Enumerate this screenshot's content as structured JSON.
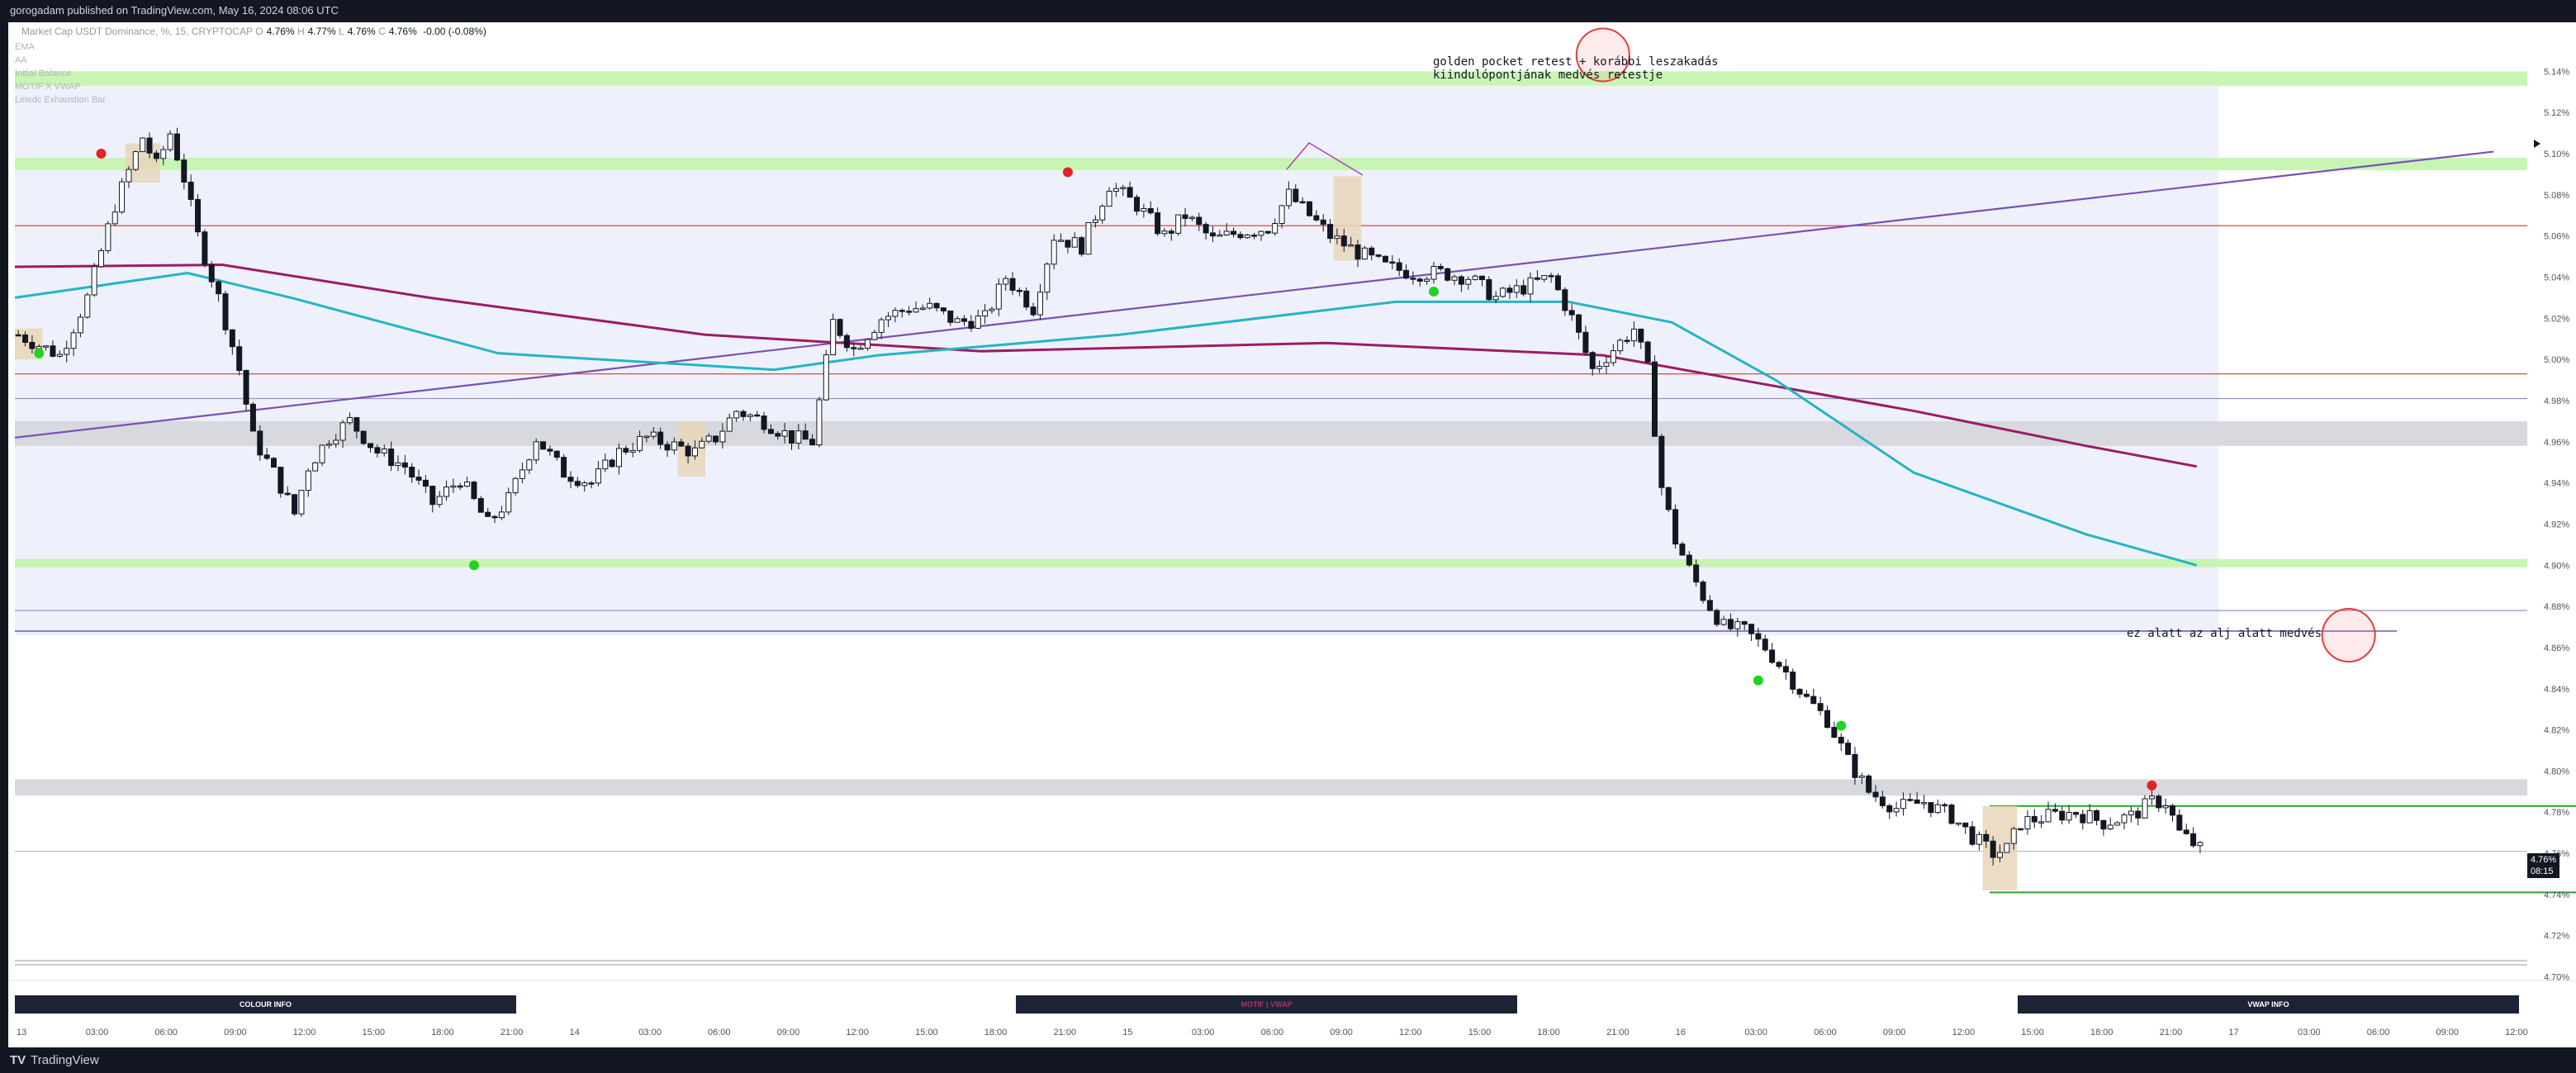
{
  "header": {
    "publish_line": "gorogadam published on TradingView.com, May 16, 2024 08:06 UTC"
  },
  "footer": {
    "brand": "TradingView"
  },
  "legend": {
    "symbol": "Market Cap USDT Dominance, %, 15, CRYPTOCAP",
    "open": "4.76%",
    "high": "4.77%",
    "low": "4.76%",
    "close": "4.76%",
    "change": "-0.00 (-0.08%)",
    "indicators": [
      "EMA",
      "AA",
      "Initial Balance",
      "MOTIF X VWAP",
      "Leledc Exhaustion Bar"
    ]
  },
  "buttons": {
    "colour_info": "COLOUR INFO",
    "motif_vwap": "MOTIF | VWAP",
    "vwap_info": "VWAP INFO"
  },
  "annotations": {
    "golden_line1": "golden pocket retest + korábbi leszakadás",
    "golden_line2": "kiindulópontjának medvés retestje",
    "below_low": "ez alatt az alj alatt medvés"
  },
  "last_price": {
    "value": "4.76%",
    "countdown": "08:15"
  },
  "colors": {
    "ema_teal": "#26b4c4",
    "ema_maroon": "#9c1c64",
    "trendline_purple": "#7b4fb5",
    "red_level": "#e0454f",
    "green_zone": "#c8f5b4",
    "grey_zone": "#d7d9de",
    "green_level": "#2aa52a",
    "info_button_bg": "#1e2235"
  },
  "chart_data": {
    "type": "candlestick",
    "title": "Market Cap USDT Dominance, %, 15, CRYPTOCAP",
    "y_unit": "%",
    "ylim": [
      4.695,
      5.155
    ],
    "y_ticks": [
      "5.14%",
      "5.12%",
      "5.10%",
      "5.08%",
      "5.06%",
      "5.04%",
      "5.02%",
      "5.00%",
      "4.98%",
      "4.96%",
      "4.94%",
      "4.92%",
      "4.90%",
      "4.88%",
      "4.86%",
      "4.84%",
      "4.82%",
      "4.80%",
      "4.78%",
      "4.76%",
      "4.74%",
      "4.72%",
      "4.70%"
    ],
    "x_ticks": [
      "13",
      "03:00",
      "06:00",
      "09:00",
      "12:00",
      "15:00",
      "18:00",
      "21:00",
      "14",
      "03:00",
      "06:00",
      "09:00",
      "12:00",
      "15:00",
      "18:00",
      "21:00",
      "15",
      "03:00",
      "06:00",
      "09:00",
      "12:00",
      "15:00",
      "18:00",
      "21:00",
      "16",
      "03:00",
      "06:00",
      "09:00",
      "12:00",
      "15:00",
      "18:00",
      "21:00",
      "17",
      "03:00",
      "06:00",
      "09:00",
      "12:00"
    ],
    "price_path": [
      [
        0,
        5.012
      ],
      [
        6,
        5.002
      ],
      [
        10,
        5.03
      ],
      [
        14,
        5.075
      ],
      [
        18,
        5.108
      ],
      [
        20,
        5.094
      ],
      [
        22,
        5.11
      ],
      [
        24,
        5.088
      ],
      [
        26,
        5.06
      ],
      [
        29,
        5.03
      ],
      [
        32,
        4.995
      ],
      [
        34,
        4.962
      ],
      [
        37,
        4.945
      ],
      [
        40,
        4.925
      ],
      [
        42,
        4.948
      ],
      [
        45,
        4.962
      ],
      [
        48,
        4.97
      ],
      [
        52,
        4.955
      ],
      [
        56,
        4.948
      ],
      [
        60,
        4.93
      ],
      [
        64,
        4.942
      ],
      [
        68,
        4.92
      ],
      [
        71,
        4.932
      ],
      [
        75,
        4.962
      ],
      [
        79,
        4.945
      ],
      [
        83,
        4.94
      ],
      [
        87,
        4.955
      ],
      [
        91,
        4.962
      ],
      [
        95,
        4.958
      ],
      [
        98,
        4.955
      ],
      [
        101,
        4.962
      ],
      [
        104,
        4.975
      ],
      [
        108,
        4.97
      ],
      [
        112,
        4.962
      ],
      [
        115,
        4.96
      ],
      [
        118,
        5.018
      ],
      [
        121,
        5.005
      ],
      [
        125,
        5.02
      ],
      [
        129,
        5.025
      ],
      [
        132,
        5.025
      ],
      [
        136,
        5.018
      ],
      [
        140,
        5.02
      ],
      [
        143,
        5.04
      ],
      [
        147,
        5.025
      ],
      [
        150,
        5.06
      ],
      [
        154,
        5.055
      ],
      [
        158,
        5.085
      ],
      [
        162,
        5.075
      ],
      [
        166,
        5.06
      ],
      [
        169,
        5.07
      ],
      [
        173,
        5.058
      ],
      [
        177,
        5.062
      ],
      [
        181,
        5.064
      ],
      [
        184,
        5.08
      ],
      [
        187,
        5.07
      ],
      [
        190,
        5.06
      ],
      [
        194,
        5.052
      ],
      [
        198,
        5.045
      ],
      [
        202,
        5.042
      ],
      [
        206,
        5.042
      ],
      [
        210,
        5.04
      ],
      [
        214,
        5.03
      ],
      [
        218,
        5.035
      ],
      [
        222,
        5.04
      ],
      [
        225,
        5.02
      ],
      [
        228,
        4.995
      ],
      [
        231,
        5.005
      ],
      [
        234,
        5.015
      ],
      [
        236,
        4.995
      ],
      [
        238,
        4.938
      ],
      [
        240,
        4.912
      ],
      [
        242,
        4.898
      ],
      [
        244,
        4.885
      ],
      [
        247,
        4.87
      ],
      [
        250,
        4.868
      ],
      [
        253,
        4.86
      ],
      [
        256,
        4.848
      ],
      [
        259,
        4.835
      ],
      [
        262,
        4.825
      ],
      [
        265,
        4.805
      ],
      [
        268,
        4.79
      ],
      [
        272,
        4.782
      ],
      [
        276,
        4.785
      ],
      [
        280,
        4.778
      ],
      [
        283,
        4.768
      ],
      [
        286,
        4.76
      ],
      [
        288,
        4.762
      ],
      [
        290,
        4.775
      ],
      [
        294,
        4.778
      ],
      [
        298,
        4.78
      ],
      [
        302,
        4.775
      ],
      [
        306,
        4.778
      ],
      [
        309,
        4.785
      ],
      [
        311,
        4.785
      ],
      [
        313,
        4.77
      ],
      [
        316,
        4.762
      ]
    ],
    "ema_teal": [
      [
        0,
        5.03
      ],
      [
        25,
        5.042
      ],
      [
        40,
        5.03
      ],
      [
        70,
        5.003
      ],
      [
        110,
        4.995
      ],
      [
        125,
        5.002
      ],
      [
        160,
        5.012
      ],
      [
        200,
        5.028
      ],
      [
        225,
        5.028
      ],
      [
        240,
        5.018
      ],
      [
        255,
        4.99
      ],
      [
        275,
        4.945
      ],
      [
        300,
        4.915
      ],
      [
        316,
        4.9
      ]
    ],
    "ema_maroon": [
      [
        0,
        5.045
      ],
      [
        30,
        5.046
      ],
      [
        60,
        5.03
      ],
      [
        100,
        5.012
      ],
      [
        140,
        5.004
      ],
      [
        190,
        5.008
      ],
      [
        230,
        5.002
      ],
      [
        250,
        4.99
      ],
      [
        275,
        4.975
      ],
      [
        300,
        4.958
      ],
      [
        316,
        4.948
      ]
    ],
    "trendline": {
      "from": [
        0,
        4.962
      ],
      "to": [
        359,
        5.101
      ]
    },
    "zones": [
      {
        "type": "green",
        "y1": 5.133,
        "y2": 5.14
      },
      {
        "type": "green",
        "y1": 5.092,
        "y2": 5.098
      },
      {
        "type": "green",
        "y1": 4.899,
        "y2": 4.903
      },
      {
        "type": "grey",
        "y1": 4.958,
        "y2": 4.97
      },
      {
        "type": "grey",
        "y1": 4.788,
        "y2": 4.796
      }
    ],
    "levels": [
      {
        "color": "red",
        "y": 5.065
      },
      {
        "color": "red",
        "y": 4.993
      },
      {
        "color": "purple",
        "y": 4.981
      },
      {
        "color": "purple",
        "y": 4.878
      },
      {
        "color": "green",
        "y": 4.783,
        "x1": 286,
        "x2": 429
      },
      {
        "color": "green",
        "y": 4.741,
        "x1": 286,
        "x2": 429
      },
      {
        "color": "grey",
        "y": 4.761
      }
    ],
    "markers": [
      {
        "color": "red",
        "x": 12,
        "y": 5.1
      },
      {
        "color": "green",
        "x": 3,
        "y": 5.003
      },
      {
        "color": "red",
        "x": 152,
        "y": 5.091
      },
      {
        "color": "green",
        "x": 66,
        "y": 4.9
      },
      {
        "color": "green",
        "x": 205,
        "y": 5.033
      },
      {
        "color": "green",
        "x": 252,
        "y": 4.844
      },
      {
        "color": "green",
        "x": 264,
        "y": 4.822
      },
      {
        "color": "red",
        "x": 309,
        "y": 4.793
      }
    ],
    "initial_balance_region": {
      "x1": 0,
      "x2": 318,
      "y1": 5.14,
      "y2": 4.866
    },
    "exhaustion_boxes": [
      {
        "x1": 0,
        "x2": 4,
        "y1": 5.015,
        "y2": 5.0
      },
      {
        "x1": 16,
        "x2": 21,
        "y1": 5.105,
        "y2": 5.086
      },
      {
        "x1": 96,
        "x2": 100,
        "y1": 4.97,
        "y2": 4.943
      },
      {
        "x1": 191,
        "x2": 195,
        "y1": 5.089,
        "y2": 5.048
      },
      {
        "x1": 285,
        "x2": 290,
        "y1": 4.783,
        "y2": 4.742
      }
    ],
    "circles": [
      {
        "x": 230,
        "y": 5.148
      },
      {
        "x": 338,
        "y": 4.866
      }
    ],
    "last_price": 4.76
  }
}
